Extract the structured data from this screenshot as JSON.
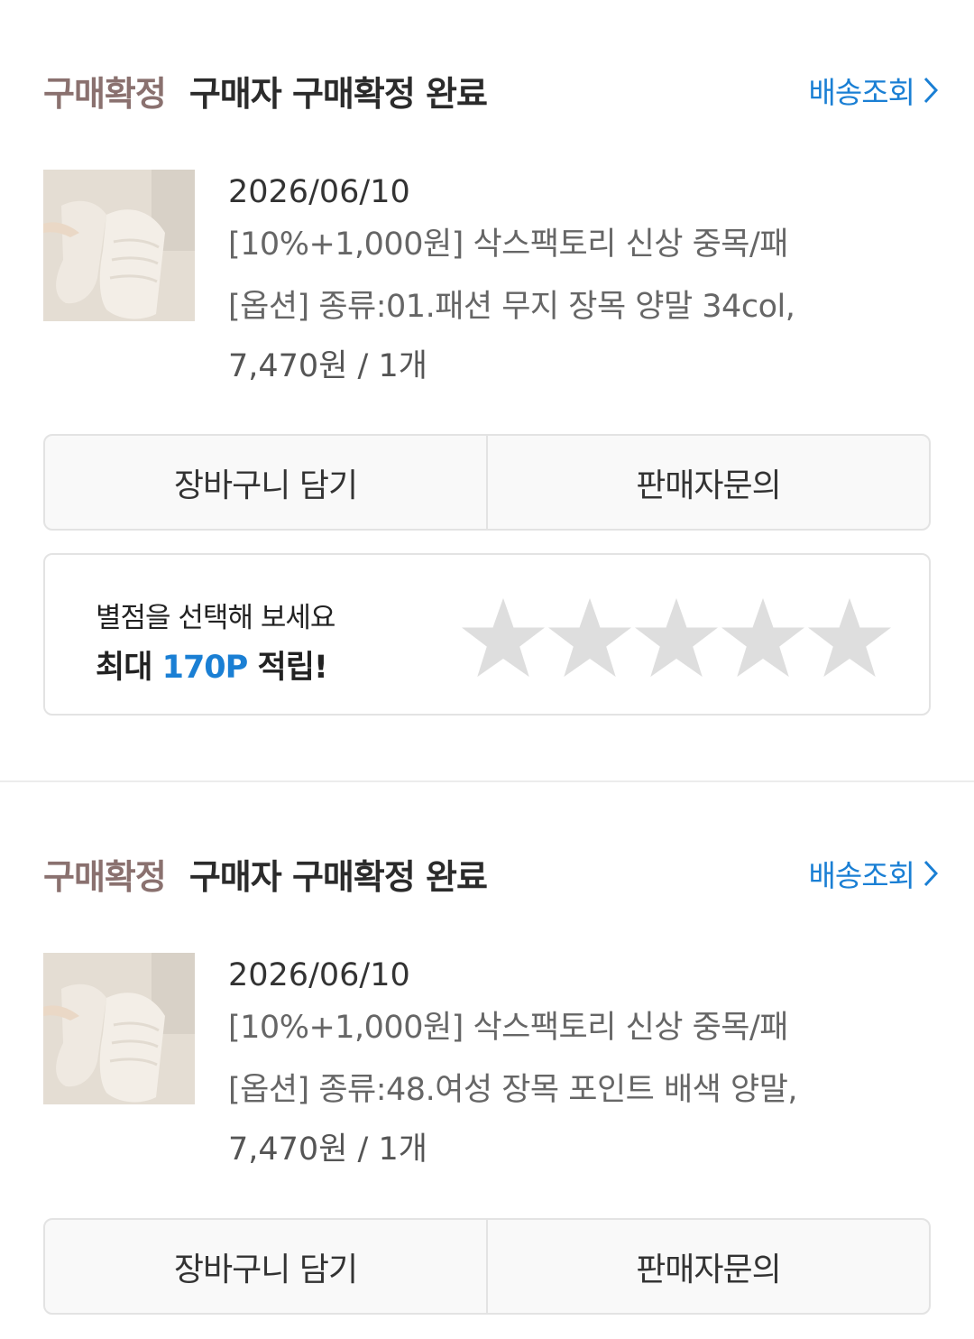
{
  "orders": [
    {
      "status_label": "구매확정",
      "status_desc": "구매자 구매확정 완료",
      "track_label": "배송조회",
      "date": "2026/06/10",
      "product_name": "[10%+1,000원] 삭스팩토리 신상 중목/패",
      "option": "[옵션] 종류:01.패션 무지 장목 양말 34col,",
      "price_qty": "7,470원 / 1개",
      "cart_button": "장바구니 담기",
      "inquiry_button": "판매자문의",
      "review": {
        "prompt": "별점을 선택해 보세요",
        "reward_prefix": "최대 ",
        "reward_points": "170P",
        "reward_suffix": " 적립!",
        "stars": 5,
        "selected": 0
      }
    },
    {
      "status_label": "구매확정",
      "status_desc": "구매자 구매확정 완료",
      "track_label": "배송조회",
      "date": "2026/06/10",
      "product_name": "[10%+1,000원] 삭스팩토리 신상 중목/패",
      "option": "[옵션] 종류:48.여성 장목 포인트 배색 양말,",
      "price_qty": "7,470원 / 1개",
      "cart_button": "장바구니 담기",
      "inquiry_button": "판매자문의"
    }
  ],
  "colors": {
    "status_label": "#8a716f",
    "link_blue": "#1a7fd4",
    "star_empty": "#dedede",
    "divider": "#ececec"
  },
  "icons": [
    "chevron-right-icon",
    "star-icon"
  ]
}
